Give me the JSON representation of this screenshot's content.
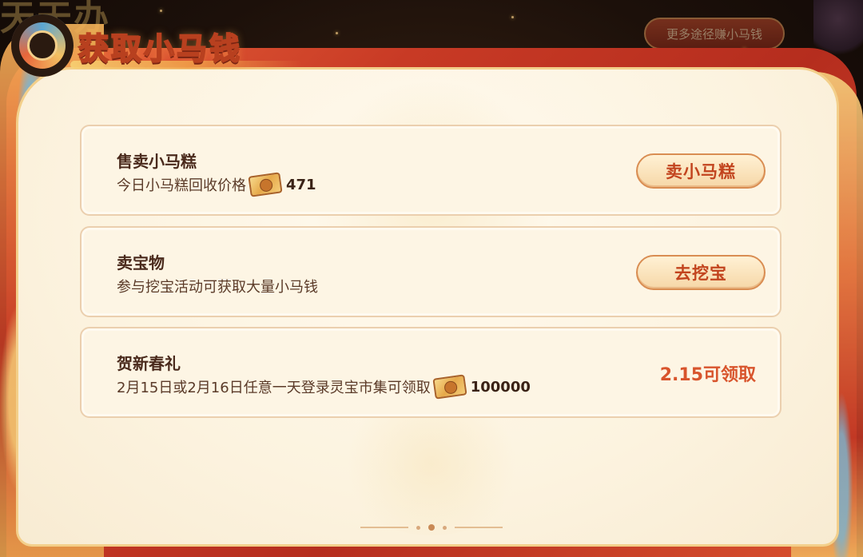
{
  "background": {
    "game_title": "天天办",
    "more_ways_button": "更多途径赚小马钱"
  },
  "header": {
    "title": "获取小马钱"
  },
  "cards": [
    {
      "title": "售卖小马糕",
      "desc_prefix": "今日小马糕回收价格",
      "currency_icon": "cash-icon",
      "amount": "471",
      "action_label": "卖小马糕"
    },
    {
      "title": "卖宝物",
      "desc_prefix": "参与挖宝活动可获取大量小马钱",
      "action_label": "去挖宝"
    },
    {
      "title": "贺新春礼",
      "desc_prefix": "2月15日或2月16日任意一天登录灵宝市集可领取",
      "currency_icon": "cash-icon",
      "amount": "100000",
      "status_label": "2.15可领取"
    }
  ],
  "colors": {
    "frame_red": "#c83a25",
    "panel_cream": "#fdf5e4",
    "accent_orange": "#d8542c",
    "text_brown": "#4a2a1c"
  }
}
